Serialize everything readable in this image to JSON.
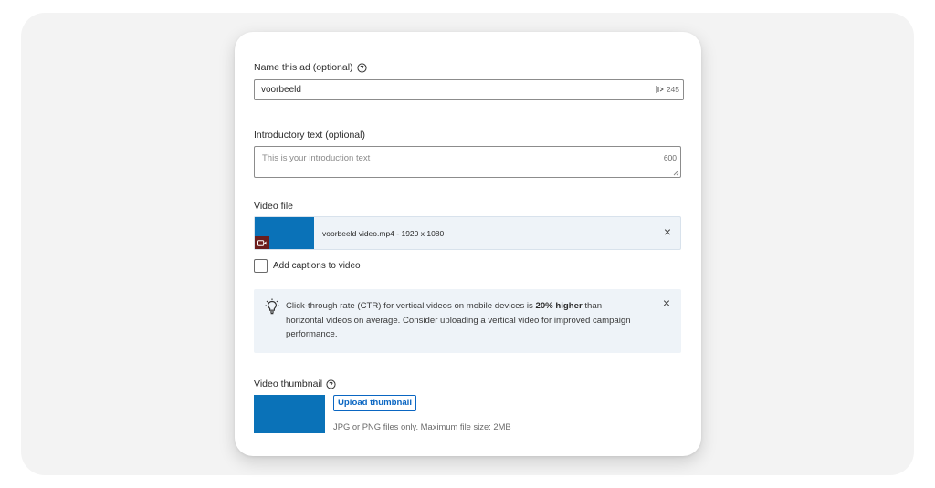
{
  "form": {
    "name_ad": {
      "label": "Name this ad (optional)",
      "value": "voorbeeld",
      "char_counter": "245",
      "icons": [
        "help-icon",
        "text-direction-icon"
      ]
    },
    "intro_text": {
      "label": "Introductory text (optional)",
      "placeholder": "This is your introduction text",
      "char_counter": "600"
    },
    "video_file": {
      "label": "Video file",
      "file_info": "voorbeeld video.mp4 - 1920 x 1080",
      "remove_symbol": "×",
      "icons": [
        "video-camera-icon",
        "close-icon"
      ]
    },
    "captions": {
      "label": "Add captions to video",
      "checked": false
    },
    "tip": {
      "text_before": "Click-through rate (CTR) for vertical videos on mobile devices is ",
      "text_bold": "20% higher",
      "text_after": " than horizontal videos on average. Consider uploading a vertical video for improved campaign performance.",
      "dismiss_symbol": "×",
      "icons": [
        "lightbulb-icon",
        "close-icon"
      ]
    },
    "video_thumbnail": {
      "label": "Video thumbnail",
      "button_label": "Upload thumbnail",
      "hint": "JPG or PNG files only. Maximum file size: 2MB"
    }
  },
  "colors": {
    "page_background": "#ffffff",
    "panel_background": "#f3f3f3",
    "card_background": "#ffffff",
    "thumbnail_placeholder": "#0a72b8",
    "accent_blue": "#0a66c2",
    "info_background": "#eef3f8",
    "camera_badge": "#6b1d1d"
  }
}
